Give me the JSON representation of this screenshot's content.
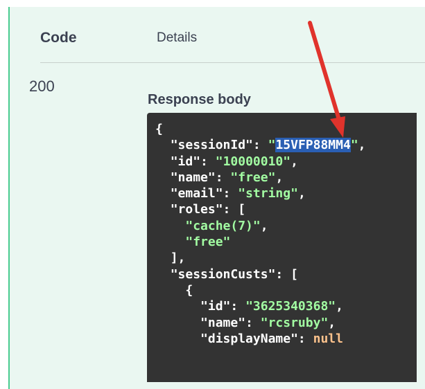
{
  "table": {
    "header_code": "Code",
    "header_details": "Details",
    "status_code": "200",
    "response_body_label": "Response body"
  },
  "response": {
    "open_brace": "{",
    "session_id_key": "\"sessionId\"",
    "session_id_value": "15VFP88MM4",
    "id_key": "\"id\"",
    "id_value": "\"10000010\"",
    "name_key": "\"name\"",
    "name_value": "\"free\"",
    "email_key": "\"email\"",
    "email_value": "\"string\"",
    "roles_key": "\"roles\"",
    "role_1": "\"cache(7)\"",
    "role_2": "\"free\"",
    "session_custs_key": "\"sessionCusts\"",
    "cust_id_key": "\"id\"",
    "cust_id_value": "\"3625340368\"",
    "cust_name_key": "\"name\"",
    "cust_name_value": "\"rcsruby\"",
    "cust_display_name_key": "\"displayName\"",
    "cust_display_name_value": "null"
  },
  "colors": {
    "panel_bg": "#eaf7f1",
    "panel_border": "#49cc90",
    "code_bg": "#333333",
    "string": "#a2fca2",
    "null": "#fcc28c",
    "selection": "#2a5fb4",
    "arrow": "#e0332c"
  },
  "annotation": {
    "arrow_icon": "red-arrow-pointing-down"
  }
}
